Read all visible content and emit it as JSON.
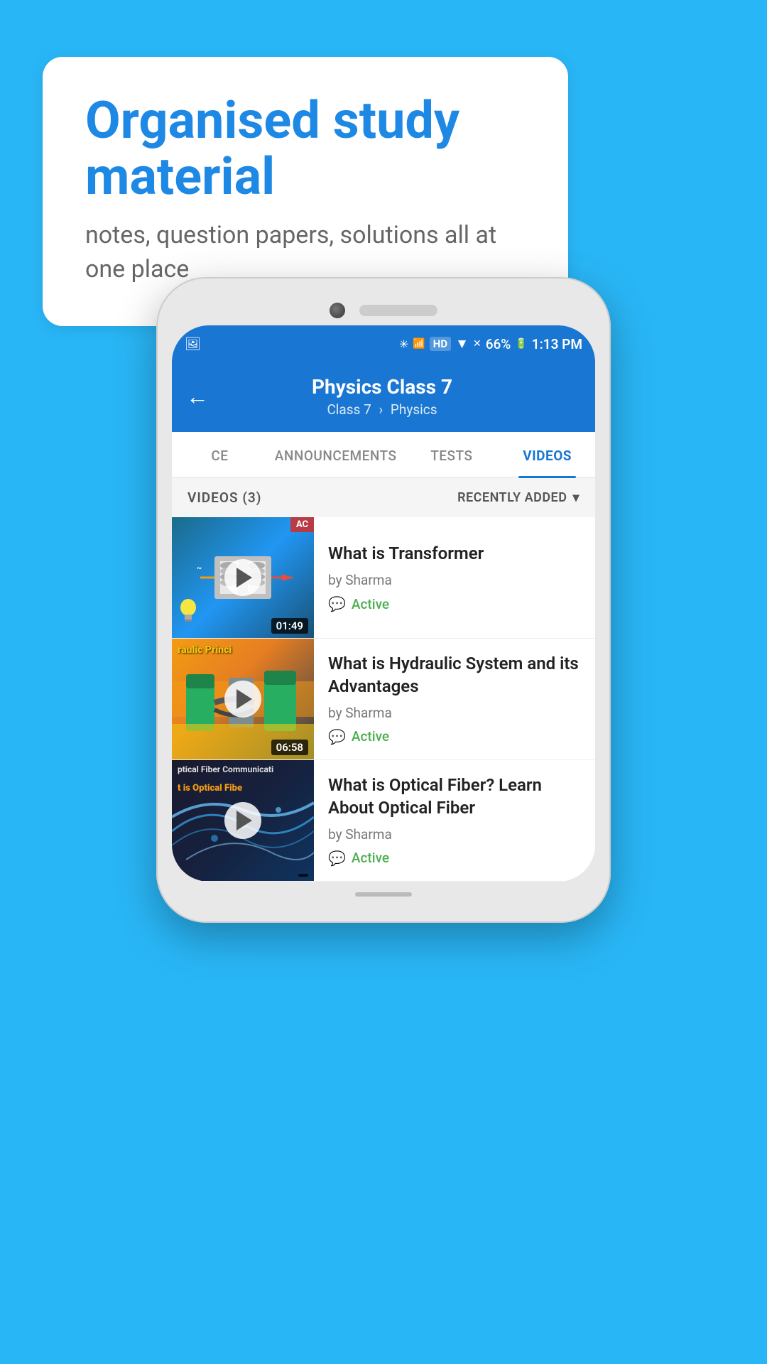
{
  "hero": {
    "title": "Organised study material",
    "subtitle": "notes, question papers, solutions all at one place"
  },
  "phone": {
    "statusBar": {
      "bluetooth": "BT",
      "signal": "HD",
      "battery": "66%",
      "time": "1:13 PM"
    },
    "header": {
      "backLabel": "←",
      "title": "Physics Class 7",
      "breadcrumb1": "Class 7",
      "breadcrumb2": "Physics"
    },
    "tabs": [
      {
        "label": "CE",
        "active": false
      },
      {
        "label": "ANNOUNCEMENTS",
        "active": false
      },
      {
        "label": "TESTS",
        "active": false
      },
      {
        "label": "VIDEOS",
        "active": true
      }
    ],
    "filterBar": {
      "count": "VIDEOS (3)",
      "sort": "RECENTLY ADDED"
    },
    "videos": [
      {
        "title": "What is  Transformer",
        "author": "by Sharma",
        "status": "Active",
        "duration": "01:49",
        "thumbType": "transformer",
        "thumbTag": "AC"
      },
      {
        "title": "What is Hydraulic System and its Advantages",
        "author": "by Sharma",
        "status": "Active",
        "duration": "06:58",
        "thumbType": "hydraulic",
        "thumbText": "raulic Princi"
      },
      {
        "title": "What is Optical Fiber? Learn About Optical Fiber",
        "author": "by Sharma",
        "status": "Active",
        "duration": "",
        "thumbType": "optical",
        "thumbText1": "ptical Fiber Communicati",
        "thumbText2": " is Optical Fibe"
      }
    ]
  }
}
